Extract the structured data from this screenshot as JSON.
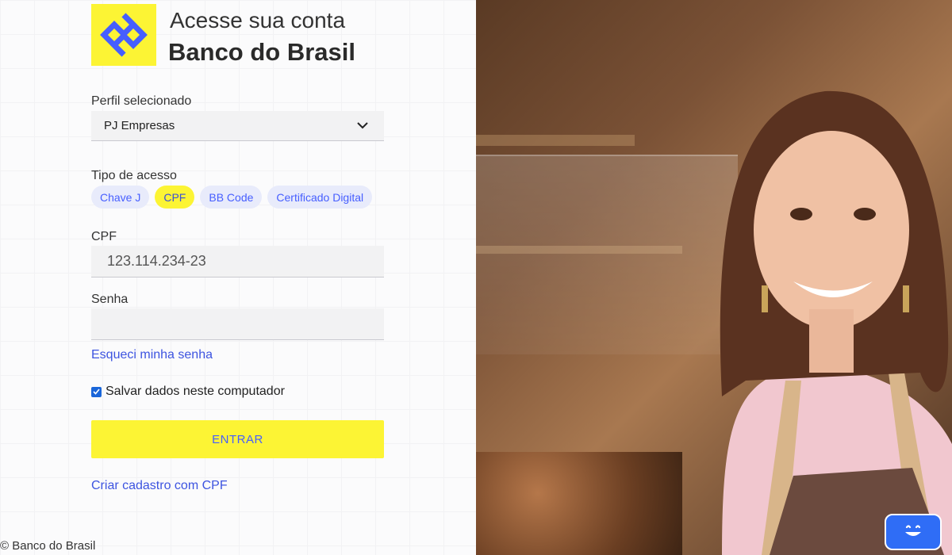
{
  "header": {
    "subtitle": "Acesse sua conta",
    "title": "Banco do Brasil"
  },
  "profile": {
    "label": "Perfil selecionado",
    "value": "PJ Empresas"
  },
  "access": {
    "label": "Tipo de acesso",
    "options": [
      "Chave J",
      "CPF",
      "BB Code",
      "Certificado Digital"
    ],
    "selected": "CPF"
  },
  "cpf": {
    "label": "CPF",
    "value": "123.114.234-23"
  },
  "password": {
    "label": "Senha",
    "value": ""
  },
  "links": {
    "forgot": "Esqueci minha senha",
    "register": "Criar cadastro com CPF"
  },
  "remember": {
    "label": "Salvar dados neste computador",
    "checked": true
  },
  "submit": {
    "label": "ENTRAR"
  },
  "footer": {
    "text": "© Banco do Brasil"
  },
  "colors": {
    "brand_yellow": "#fcf434",
    "brand_blue": "#465eff",
    "chat_blue": "#2f6df6"
  },
  "icons": {
    "logo": "banco-do-brasil-logo",
    "dropdown": "chevron-down-icon",
    "chat": "chat-bot-icon"
  }
}
